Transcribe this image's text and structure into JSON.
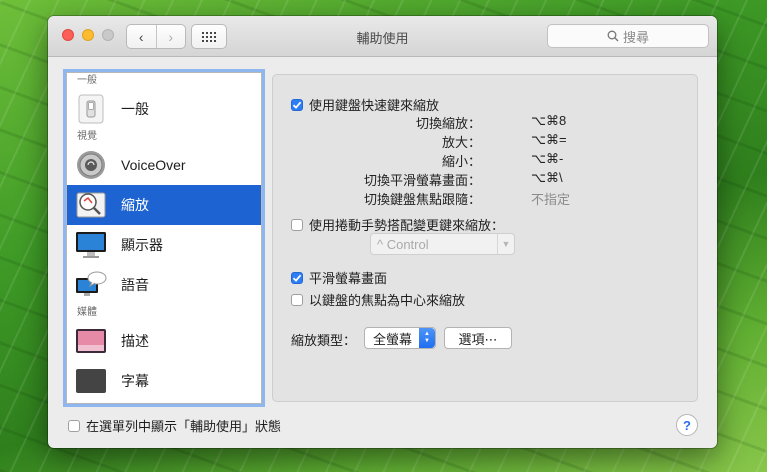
{
  "window": {
    "title": "輔助使用"
  },
  "toolbar": {
    "back": "‹",
    "forward": "›",
    "search_placeholder": "搜尋"
  },
  "sidebar": {
    "sections": {
      "general": "一般",
      "vision": "視覺",
      "media": "媒體"
    },
    "items": [
      {
        "label": "一般",
        "icon": "switch-icon"
      },
      {
        "label": "VoiceOver",
        "icon": "voiceover-icon"
      },
      {
        "label": "縮放",
        "icon": "zoom-icon",
        "selected": true
      },
      {
        "label": "顯示器",
        "icon": "display-icon"
      },
      {
        "label": "語音",
        "icon": "speech-icon"
      },
      {
        "label": "描述",
        "icon": "descriptions-icon"
      },
      {
        "label": "字幕",
        "icon": "captions-icon"
      }
    ]
  },
  "zoom": {
    "keyboard_shortcuts_label": "使用鍵盤快速鍵來縮放",
    "keyboard_shortcuts_checked": true,
    "shortcuts": [
      {
        "name": "切換縮放：",
        "key": "⌥⌘8"
      },
      {
        "name": "放大：",
        "key": "⌥⌘="
      },
      {
        "name": "縮小：",
        "key": "⌥⌘-"
      },
      {
        "name": "切換平滑螢幕畫面：",
        "key": "⌥⌘\\"
      },
      {
        "name": "切換鍵盤焦點跟隨：",
        "key": "不指定"
      }
    ],
    "scroll_gesture_label": "使用捲動手勢搭配變更鍵來縮放：",
    "scroll_gesture_checked": false,
    "modifier_value": "^ Control",
    "smooth_images_label": "平滑螢幕畫面",
    "smooth_images_checked": true,
    "follow_focus_label": "以鍵盤的焦點為中心來縮放",
    "follow_focus_checked": false,
    "style_label": "縮放類型：",
    "style_value": "全螢幕",
    "options_button": "選項⋯"
  },
  "footer": {
    "menu_status_label": "在選單列中顯示「輔助使用」狀態",
    "menu_status_checked": false,
    "help": "?"
  },
  "colors": {
    "selection": "#1d63d1",
    "checkbox_on": "#2d7df6"
  }
}
